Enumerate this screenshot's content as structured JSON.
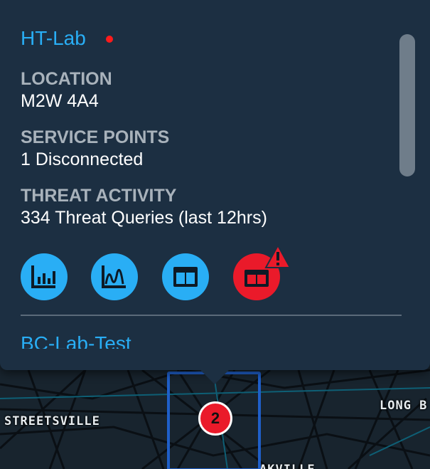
{
  "map": {
    "labels": {
      "streetsville": "STREETSVILLE",
      "long_branch": "LONG B",
      "oakville": "AKVILLE"
    },
    "cluster_count": "2"
  },
  "popup": {
    "site": {
      "name": "HT-Lab",
      "status_color": "#ff1b1b"
    },
    "location": {
      "label": "LOCATION",
      "value": "M2W 4A4"
    },
    "service_points": {
      "label": "SERVICE POINTS",
      "value": "1 Disconnected"
    },
    "threat_activity": {
      "label": "THREAT ACTIVITY",
      "value": "334 Threat Queries (last 12hrs)"
    },
    "actions": [
      "bar-chart-icon",
      "line-chart-icon",
      "dashboard-icon",
      "dashboard-alert-icon"
    ],
    "next_site": "BC-Lab-Test"
  },
  "colors": {
    "accent": "#29aef5",
    "alert": "#ea1a2a",
    "panel": "#1c2f42"
  }
}
